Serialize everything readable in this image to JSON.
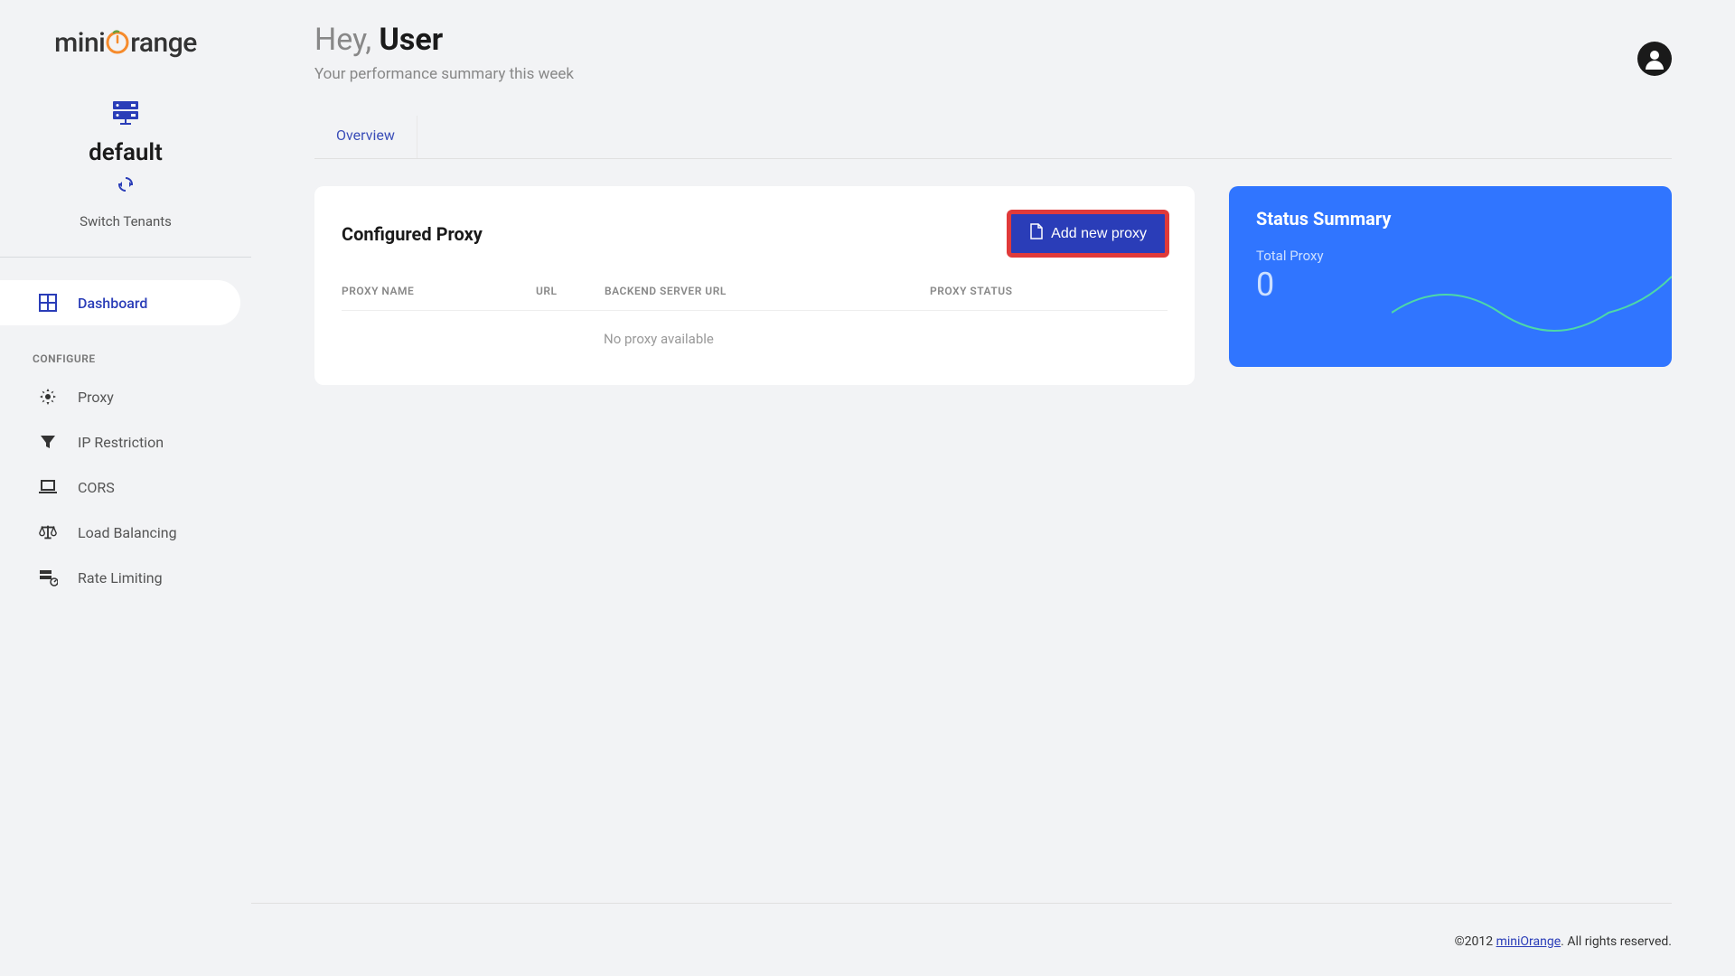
{
  "brand": {
    "part1": "mini",
    "part2": "range"
  },
  "tenant": {
    "name": "default",
    "switch_label": "Switch Tenants"
  },
  "nav": {
    "dashboard": "Dashboard",
    "section_label": "CONFIGURE",
    "items": [
      {
        "label": "Proxy"
      },
      {
        "label": "IP Restriction"
      },
      {
        "label": "CORS"
      },
      {
        "label": "Load Balancing"
      },
      {
        "label": "Rate Limiting"
      }
    ]
  },
  "header": {
    "greeting_prefix": "Hey, ",
    "username": "User",
    "subtitle": "Your performance summary this week"
  },
  "tabs": {
    "overview": "Overview"
  },
  "proxy_card": {
    "title": "Configured Proxy",
    "add_btn": "Add new proxy",
    "columns": {
      "name": "PROXY NAME",
      "url": "URL",
      "backend": "BACKEND SERVER URL",
      "status": "PROXY STATUS"
    },
    "empty": "No proxy available"
  },
  "status_card": {
    "title": "Status Summary",
    "label": "Total Proxy",
    "value": "0"
  },
  "footer": {
    "copyright": "©2012 ",
    "link": "miniOrange",
    "rights": ". All rights reserved."
  }
}
